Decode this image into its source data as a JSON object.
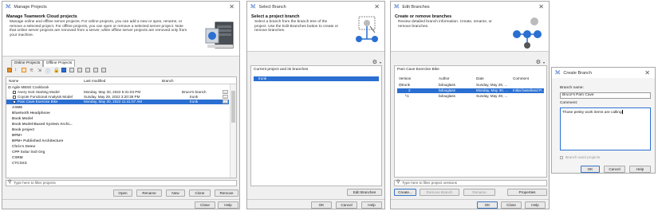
{
  "colors": {
    "selection": "#2a6fd1",
    "title_icon": "#3a6fc4"
  },
  "manage": {
    "title": "Manage Projects",
    "header_title": "Manage Teamwork Cloud projects",
    "header_desc": [
      "Manage online and offline server projects. For online projects, you can add a new or open, rename, or",
      "remove a selected project. For offline projects, you can open or remove a selected server project. Note",
      "that online server projects are removed from a server, while offline server projects are removed only from",
      "your machine."
    ],
    "tabs": [
      "Online Projects",
      "Offline Projects"
    ],
    "columns": [
      "Name",
      "Last modified",
      "Branch"
    ],
    "group": "Agile MBSE Cookbook",
    "rows": [
      {
        "name": "Avery SoS Starting Model",
        "modified": "Monday, May 30, 2022 5:31:03 PM",
        "branch": "Bruce's branch"
      },
      {
        "name": "Coyote Functional Analysis Model",
        "modified": "Sunday, May 29, 2022 3:20:38 PM",
        "branch": "trunk"
      },
      {
        "name": "Pam Cave Exercise Bike",
        "modified": "Monday, May 30, 2022 11:41:57 AM",
        "branch": "trunk"
      }
    ],
    "projects": [
      "ASME",
      "Bluetooth Headphone",
      "Book Model",
      "Book Model-Based System Archi...",
      "Book project",
      "BPM+",
      "BPM+ Published Architecture",
      "Chris's Demo",
      "CPP Solar Soil Org",
      "CSRM",
      "CTCSXS"
    ],
    "filter_placeholder": "Type here to filter projects",
    "buttons": [
      "Open",
      "Rename",
      "New",
      "Clone",
      "Remove"
    ],
    "close": "Close",
    "help": "Help"
  },
  "select": {
    "title": "Select Branch",
    "header_title": "Select a project branch",
    "header_desc": [
      "Select a branch from the branch tree of the",
      "project. Use the Edit Branches button to create or",
      "remove branches."
    ],
    "section": "Current project and its branches",
    "item": "trunk",
    "edit_button": "Edit Branches",
    "ok": "OK",
    "cancel": "Cancel",
    "help": "Help"
  },
  "edit": {
    "title": "Edit Branches",
    "header_title": "Create or remove branches",
    "header_desc": [
      "Review detailed branch information. Create, rename, or",
      "remove branches."
    ],
    "project": "Pam Cave Exercise Bike",
    "columns": [
      "Version",
      "Author",
      "Date",
      "Comment"
    ],
    "rows": [
      {
        "version": "trunk",
        "author": "bdouglass",
        "date": "Sunday, May 29, ...",
        "comment": ""
      },
      {
        "version": "2",
        "author": "bdouglass",
        "date": "Monday, May 30, ...",
        "comment": "Initial baselined P..."
      },
      {
        "version": "1",
        "author": "bdouglass",
        "date": "Sunday, May 29, ...",
        "comment": ""
      }
    ],
    "filter_placeholder": "Type here to filter project versions",
    "buttons": [
      "Create...",
      "Remove Branch",
      "Rename",
      "Properties"
    ],
    "ok": "OK",
    "close": "Close",
    "help": "Help"
  },
  "create": {
    "title": "Create Branch",
    "name_label": "Branch name:",
    "name_value": "Bruce's Pam Cave",
    "comment_label": "Comment:",
    "comment_value": "Those pesky work items are calling",
    "used_projects": "Branch used projects",
    "ok": "OK",
    "cancel": "Cancel",
    "help": "Help"
  }
}
